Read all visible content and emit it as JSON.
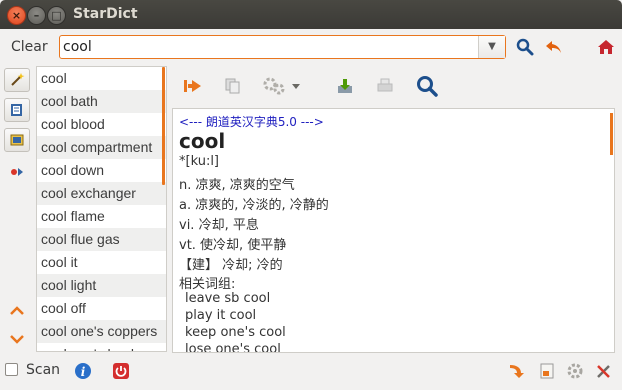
{
  "window": {
    "title": "StarDict"
  },
  "search": {
    "clear_label": "Clear",
    "query": "cool"
  },
  "wordlist": {
    "items": [
      "cool",
      "cool bath",
      "cool blood",
      "cool compartment",
      "cool down",
      "cool exchanger",
      "cool flame",
      "cool flue gas",
      "cool it",
      "cool light",
      "cool off",
      "cool one's coppers",
      "cool one's heels"
    ]
  },
  "definition": {
    "dict_name": "<--- 朗道英汉字典5.0 --->",
    "headword": "cool",
    "lines": [
      "*[ku:l]",
      "n. 凉爽, 凉爽的空气",
      "a. 凉爽的, 冷淡的, 冷静的",
      "vi. 冷却, 平息",
      "vt. 使冷却, 使平静",
      "【建】 冷却; 冷的",
      "相关词组:"
    ],
    "phrases": [
      "leave sb cool",
      "play it cool",
      "keep one's cool",
      "lose one's cool"
    ]
  },
  "bottom": {
    "scan_label": "Scan"
  },
  "colors": {
    "accent": "#e9761e",
    "titlebar": "#3c3b37",
    "dict_name": "#1f1fbf"
  }
}
